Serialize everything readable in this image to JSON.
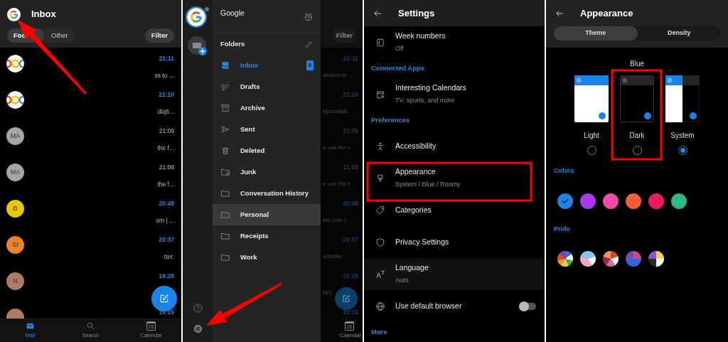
{
  "inbox_screen": {
    "title": "Inbox",
    "tabs": [
      {
        "label": "Foc",
        "selected": true
      },
      {
        "label": "Other",
        "selected": false
      }
    ],
    "filter": "Filter",
    "messages": [
      {
        "avatar": {
          "kind": "logo"
        },
        "time": "21:11",
        "unread": true,
        "snippet": "ss to ..."
      },
      {
        "avatar": {
          "kind": "logo"
        },
        "time": "21:10",
        "unread": true,
        "snippet": "diq6..."
      },
      {
        "avatar": {
          "kind": "initials",
          "text": "MA",
          "color": "#a5a5aa"
        },
        "time": "21:09",
        "unread": false,
        "snippet": "the f..."
      },
      {
        "avatar": {
          "kind": "initials",
          "text": "MA",
          "color": "#a5a5aa"
        },
        "time": "21:08",
        "unread": false,
        "snippet": "the f..."
      },
      {
        "avatar": {
          "kind": "initials",
          "text": "B",
          "color": "#e8c60a"
        },
        "time": "20:48",
        "unread": true,
        "snippet": "om | ..."
      },
      {
        "avatar": {
          "kind": "initials",
          "text": "SI",
          "color": "#f0822a"
        },
        "time": "20:37",
        "unread": true,
        "snippet": "tter."
      },
      {
        "avatar": {
          "kind": "initials",
          "text": "N",
          "color": "#b07a64"
        },
        "time": "19:26",
        "unread": true
      },
      {
        "avatar": {
          "kind": "blank",
          "color": "#b07a64"
        },
        "time": "19:15",
        "unread": true
      }
    ],
    "nav": [
      {
        "label": "Mail",
        "selected": true
      },
      {
        "label": "Search",
        "selected": false
      },
      {
        "label": "Calendar",
        "selected": false,
        "day": "26"
      }
    ]
  },
  "drawer_screen": {
    "account_name": "Google",
    "folders_heading": "Folders",
    "folders": [
      {
        "name": "Inbox",
        "selected": true,
        "highlighted": false,
        "count": "8"
      },
      {
        "name": "Drafts",
        "selected": false,
        "highlighted": false
      },
      {
        "name": "Archive",
        "selected": false,
        "highlighted": false
      },
      {
        "name": "Sent",
        "selected": false,
        "highlighted": false
      },
      {
        "name": "Deleted",
        "selected": false,
        "highlighted": false
      },
      {
        "name": "Junk",
        "selected": false,
        "highlighted": false
      },
      {
        "name": "Conversation History",
        "selected": false,
        "highlighted": false
      },
      {
        "name": "Personal",
        "selected": false,
        "highlighted": true
      },
      {
        "name": "Receipts",
        "selected": false,
        "highlighted": false
      },
      {
        "name": "Work",
        "selected": false,
        "highlighted": false
      }
    ],
    "dimmed_inbox": {
      "filter": "Filter",
      "messages": [
        {
          "time": "21:11",
          "unread": true,
          "snippet": "access to ..."
        },
        {
          "time": "21:10",
          "unread": true,
          "snippet": "bjusodiq6..."
        },
        {
          "time": "21:09",
          "unread": false,
          "snippet": "e use the f..."
        },
        {
          "time": "21:08",
          "unread": false,
          "snippet": "e use the f..."
        },
        {
          "time": "20:48",
          "unread": true,
          "snippet": "ain.com | ..."
        },
        {
          "time": "20:37",
          "unread": true,
          "snippet": "wsletter."
        },
        {
          "time": "19:26",
          "unread": true,
          "snippet": "NFI"
        },
        {
          "time": "19:15",
          "unread": true
        }
      ],
      "nav_label": "Calendar",
      "calendar_day": "26"
    }
  },
  "settings_screen": {
    "title": "Settings",
    "rows": [
      {
        "kind": "item",
        "label": "Week numbers",
        "value": "Off",
        "highlighted": false
      },
      {
        "kind": "section",
        "label": "Connected Apps"
      },
      {
        "kind": "item",
        "label": "Interesting Calendars",
        "value": "TV, sports, and more",
        "highlighted": false
      },
      {
        "kind": "section",
        "label": "Preferences"
      },
      {
        "kind": "item",
        "label": "Accessibility",
        "highlighted": false
      },
      {
        "kind": "item",
        "label": "Appearance",
        "value": "System / Blue / Roomy",
        "highlighted": false
      },
      {
        "kind": "item",
        "label": "Categories",
        "highlighted": false
      },
      {
        "kind": "item",
        "label": "Privacy Settings",
        "highlighted": false
      },
      {
        "kind": "item",
        "label": "Language",
        "value": "Auto",
        "highlighted": true
      },
      {
        "kind": "toggle",
        "label": "Use default browser",
        "on": false,
        "highlighted": false
      },
      {
        "kind": "section",
        "label": "More"
      }
    ]
  },
  "appearance_screen": {
    "title": "Appearance",
    "tabs": [
      {
        "label": "Theme",
        "selected": true
      },
      {
        "label": "Density",
        "selected": false
      }
    ],
    "color_name": "Blue",
    "themes": [
      {
        "label": "Light",
        "kind": "light",
        "selected": false
      },
      {
        "label": "Dark",
        "kind": "dark",
        "selected": false
      },
      {
        "label": "System",
        "kind": "system",
        "selected": true
      }
    ],
    "colors_heading": "Colors",
    "colors": [
      {
        "color": "#1a84e8",
        "selected": true
      },
      {
        "color": "#a638ef",
        "selected": false
      },
      {
        "color": "#f24aa8",
        "selected": false
      },
      {
        "color": "#ff5b34",
        "selected": false
      },
      {
        "color": "#f01a5c",
        "selected": false
      },
      {
        "color": "#2db884",
        "selected": false
      }
    ],
    "pride_heading": "Pride",
    "pride": [
      {
        "selected": false
      },
      {
        "selected": false
      },
      {
        "selected": false
      },
      {
        "selected": false
      },
      {
        "selected": false
      }
    ]
  }
}
